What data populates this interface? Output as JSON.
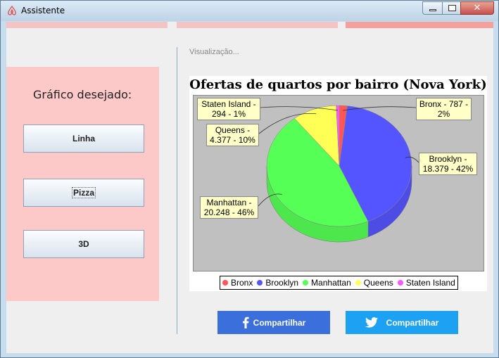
{
  "window": {
    "title": "Assistente",
    "icon": "airbnb-logo-icon"
  },
  "left_panel": {
    "prompt": "Gráfico desejado:",
    "buttons": [
      {
        "label": "Linha"
      },
      {
        "label": "Pizza"
      },
      {
        "label": "3D"
      }
    ]
  },
  "visualization_label": "Visualização...",
  "chart_data": {
    "type": "pie",
    "title": "Ofertas de quartos por bairro (Nova York)",
    "labels": [
      "Bronx",
      "Brooklyn",
      "Manhattan",
      "Queens",
      "Staten Island"
    ],
    "values": [
      787,
      18379,
      20248,
      4377,
      294
    ],
    "colors": [
      "#ff5555",
      "#5555ff",
      "#55ff55",
      "#ffff55",
      "#ff55ff"
    ],
    "callouts": [
      {
        "line1": "Bronx - 787 -",
        "line2": "2%"
      },
      {
        "line1": "Brooklyn -",
        "line2": "18.379 - 42%"
      },
      {
        "line1": "Manhattan -",
        "line2": "20.248 - 46%"
      },
      {
        "line1": "Queens -",
        "line2": "4.377 - 10%"
      },
      {
        "line1": "Staten Island -",
        "line2": "294 - 1%"
      }
    ],
    "style": "3d-tilted",
    "legend_position": "bottom"
  },
  "share_buttons": {
    "facebook": {
      "label": "Compartilhar",
      "icon": "facebook-icon",
      "color": "#3b6fdc"
    },
    "twitter": {
      "label": "Compartilhar",
      "icon": "twitter-icon",
      "color": "#1da1f2"
    }
  },
  "colors": {
    "left_panel_bg": "#fcc8c8",
    "top_stripe": "#f4c3c3",
    "top_stripe_accent": "#f4a09b"
  }
}
